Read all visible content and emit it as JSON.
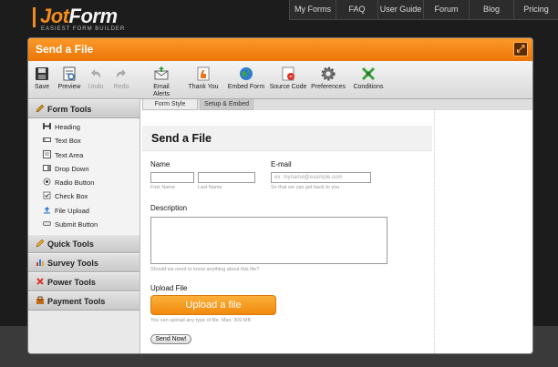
{
  "brand": {
    "name_part1": "Jot",
    "name_part2": "Form",
    "tagline": "EASIEST FORM BUILDER",
    "accent": "#f28c1b"
  },
  "topnav": [
    {
      "label": "My Forms"
    },
    {
      "label": "FAQ"
    },
    {
      "label": "User Guide"
    },
    {
      "label": "Forum"
    },
    {
      "label": "Blog"
    },
    {
      "label": "Pricing"
    }
  ],
  "panel": {
    "title": "Send a File",
    "expand_icon": "expand-icon"
  },
  "toolbar": {
    "items": [
      {
        "label": "Save",
        "icon": "save-icon",
        "enabled": true
      },
      {
        "label": "Preview",
        "icon": "preview-icon",
        "enabled": true
      },
      {
        "label": "Undo",
        "icon": "undo-icon",
        "enabled": false
      },
      {
        "label": "Redo",
        "icon": "redo-icon",
        "enabled": false
      },
      {
        "label": "Email Alerts",
        "icon": "email-alerts-icon",
        "enabled": true
      },
      {
        "label": "Thank You",
        "icon": "thank-you-icon",
        "enabled": true
      },
      {
        "label": "Embed Form",
        "icon": "globe-icon",
        "enabled": true
      },
      {
        "label": "Source Code",
        "icon": "source-code-icon",
        "enabled": true
      },
      {
        "label": "Preferences",
        "icon": "gear-icon",
        "enabled": true
      },
      {
        "label": "Conditions",
        "icon": "conditions-icon",
        "enabled": true
      }
    ]
  },
  "sidebar": {
    "form_tools": {
      "label": "Form Tools",
      "items": [
        {
          "label": "Heading",
          "icon": "heading-icon"
        },
        {
          "label": "Text Box",
          "icon": "text-box-icon"
        },
        {
          "label": "Text Area",
          "icon": "text-area-icon"
        },
        {
          "label": "Drop Down",
          "icon": "drop-down-icon"
        },
        {
          "label": "Radio Button",
          "icon": "radio-button-icon"
        },
        {
          "label": "Check Box",
          "icon": "check-box-icon"
        },
        {
          "label": "File Upload",
          "icon": "file-upload-icon"
        },
        {
          "label": "Submit Button",
          "icon": "submit-button-icon"
        }
      ]
    },
    "sections": [
      {
        "label": "Quick Tools",
        "icon": "quick-tools-icon"
      },
      {
        "label": "Survey Tools",
        "icon": "survey-tools-icon"
      },
      {
        "label": "Power Tools",
        "icon": "power-tools-icon"
      },
      {
        "label": "Payment Tools",
        "icon": "payment-tools-icon"
      }
    ]
  },
  "tabs": [
    {
      "label": "Form Style",
      "active": false
    },
    {
      "label": "Setup & Embed",
      "active": true
    }
  ],
  "form": {
    "title": "Send a File",
    "name_label": "Name",
    "first_name_sub": "First Name",
    "last_name_sub": "Last Name",
    "email_label": "E-mail",
    "email_placeholder": "ex: myname@example.com",
    "email_sub": "So that we can get back to you.",
    "description_label": "Description",
    "description_sub": "Should we need to know anything about this file?",
    "upload_label": "Upload File",
    "upload_button": "Upload a file",
    "upload_sub": "You can upload any type of file. Max: 300 MB",
    "send_button": "Send Now!"
  }
}
